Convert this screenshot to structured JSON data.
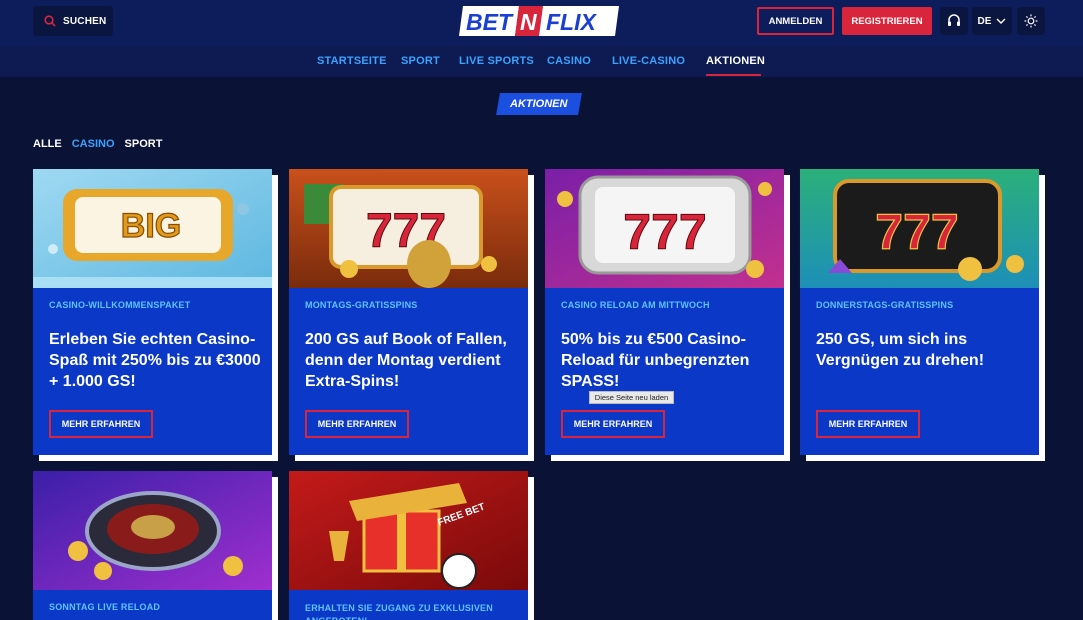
{
  "header": {
    "search_label": "SUCHEN",
    "logo_parts": [
      "BET",
      "N",
      "FLIX"
    ],
    "login_label": "ANMELDEN",
    "register_label": "REGISTRIEREN",
    "language": "DE",
    "icons": [
      "search-icon",
      "headset-icon",
      "chevron-down-icon",
      "sun-icon"
    ]
  },
  "nav": {
    "items": [
      "STARTSEITE",
      "SPORT",
      "LIVE SPORTS",
      "CASINO",
      "LIVE-CASINO",
      "AKTIONEN"
    ],
    "active": "AKTIONEN"
  },
  "page_title": "AKTIONEN",
  "filters": {
    "items": [
      "ALLE",
      "CASINO",
      "SPORT"
    ],
    "active": "CASINO"
  },
  "cards": [
    {
      "category": "CASINO-WILLKOMMENSPAKET",
      "title": "Erleben Sie echten Casino-Spaß mit 250% bis zu €3000 + 1.000 GS!",
      "button": "MEHR ERFAHREN",
      "image_text": "BIG"
    },
    {
      "category": "MONTAGS-GRATISSPINS",
      "title": "200 GS auf Book of Fallen, denn der Montag verdient Extra-Spins!",
      "button": "MEHR ERFAHREN",
      "image_text": "777"
    },
    {
      "category": "CASINO RELOAD AM MITTWOCH",
      "title": "50% bis zu €500 Casino-Reload für unbegrenzten SPASS!",
      "button": "MEHR ERFAHREN",
      "image_text": "777"
    },
    {
      "category": "DONNERSTAGS-GRATISSPINS",
      "title": "250 GS, um sich ins Vergnügen zu drehen!",
      "button": "MEHR ERFAHREN",
      "image_text": "777"
    },
    {
      "category": "SONNTAG LIVE RELOAD",
      "title": "",
      "button": "",
      "image_text": ""
    },
    {
      "category": "ERHALTEN SIE ZUGANG ZU EXKLUSIVEN ANGEBOTEN!",
      "title": "",
      "button": "",
      "image_text": "FREE BET"
    }
  ],
  "tooltip": "Diese Seite neu laden",
  "colors": {
    "background": "#0a1236",
    "header": "#0d1d5c",
    "card": "#0b38c6",
    "accent_red": "#d8253b",
    "accent_blue": "#3aa3ff"
  }
}
